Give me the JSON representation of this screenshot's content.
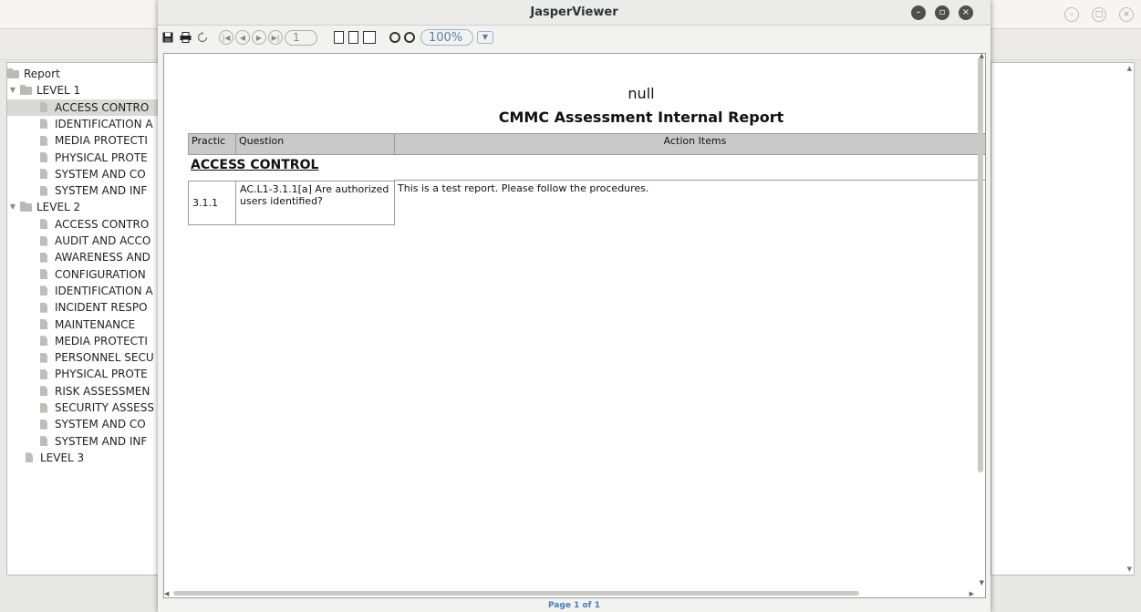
{
  "background_window": {
    "tree": {
      "root": "Report",
      "items": [
        {
          "label": "Report",
          "kind": "root"
        },
        {
          "label": "LEVEL 1",
          "kind": "folder"
        },
        {
          "label": "ACCESS CONTRO",
          "kind": "leaf",
          "selected": true
        },
        {
          "label": "IDENTIFICATION A",
          "kind": "leaf"
        },
        {
          "label": "MEDIA PROTECTI",
          "kind": "leaf"
        },
        {
          "label": "PHYSICAL PROTE",
          "kind": "leaf"
        },
        {
          "label": "SYSTEM AND CO",
          "kind": "leaf"
        },
        {
          "label": "SYSTEM AND INF",
          "kind": "leaf"
        },
        {
          "label": "LEVEL 2",
          "kind": "folder"
        },
        {
          "label": "ACCESS CONTRO",
          "kind": "leaf"
        },
        {
          "label": "AUDIT AND ACCO",
          "kind": "leaf"
        },
        {
          "label": "AWARENESS AND",
          "kind": "leaf"
        },
        {
          "label": "CONFIGURATION",
          "kind": "leaf"
        },
        {
          "label": "IDENTIFICATION A",
          "kind": "leaf"
        },
        {
          "label": "INCIDENT RESPO",
          "kind": "leaf"
        },
        {
          "label": "MAINTENANCE",
          "kind": "leaf"
        },
        {
          "label": "MEDIA PROTECTI",
          "kind": "leaf"
        },
        {
          "label": "PERSONNEL SECU",
          "kind": "leaf"
        },
        {
          "label": "PHYSICAL PROTE",
          "kind": "leaf"
        },
        {
          "label": "RISK ASSESSMEN",
          "kind": "leaf"
        },
        {
          "label": "SECURITY ASSESS",
          "kind": "leaf"
        },
        {
          "label": "SYSTEM AND CO",
          "kind": "leaf"
        },
        {
          "label": "SYSTEM AND INF",
          "kind": "leaf"
        },
        {
          "label": "LEVEL 3",
          "kind": "leaf-root"
        }
      ]
    }
  },
  "viewer": {
    "title": "JasperViewer",
    "toolbar": {
      "current_page": "1",
      "zoom": "100%"
    },
    "report": {
      "header_null": "null",
      "title": "CMMC Assessment Internal Report",
      "columns": {
        "practice": "Practic",
        "question": "Question",
        "action": "Action Items"
      },
      "group": "ACCESS CONTROL",
      "rows": [
        {
          "practice": "3.1.1",
          "question": "AC.L1-3.1.1[a] Are authorized users identified?",
          "action": "This is a test report. Please follow the procedures."
        }
      ]
    },
    "status": "Page 1 of 1"
  },
  "colors": {
    "selection": "#d9d9d6",
    "header_fill": "#c9c9c9",
    "status_text": "#4f7bb5"
  }
}
